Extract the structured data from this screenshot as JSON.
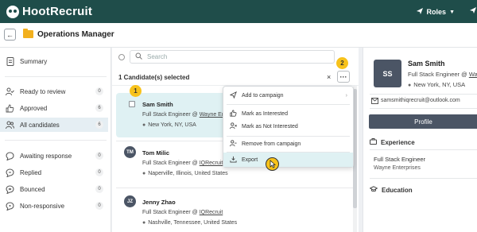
{
  "topbar": {
    "logo_text": "HootRecruit",
    "roles_label": "Roles",
    "colors": {
      "topbar_bg": "#1f4d4a",
      "accent": "#f7c21b"
    }
  },
  "header": {
    "back_icon": "arrow-left-icon",
    "title": "Operations Manager"
  },
  "sidebar": {
    "summary": "Summary",
    "items": [
      {
        "label": "Ready to review",
        "count": "0",
        "icon": "person-check-icon"
      },
      {
        "label": "Approved",
        "count": "6",
        "icon": "thumbs-up-icon"
      },
      {
        "label": "All candidates",
        "count": "6",
        "icon": "people-icon",
        "active": true
      },
      {
        "label": "Awaiting response",
        "count": "0",
        "icon": "chat-icon"
      },
      {
        "label": "Replied",
        "count": "0",
        "icon": "reply-icon"
      },
      {
        "label": "Bounced",
        "count": "0",
        "icon": "bounce-icon"
      },
      {
        "label": "Non-responsive",
        "count": "0",
        "icon": "no-response-icon"
      }
    ]
  },
  "center": {
    "search_placeholder": "Search",
    "selected_text": "1 Candidate(s) selected",
    "close_symbol": "×",
    "more_symbol": "···",
    "step_badges": [
      "1",
      "2"
    ],
    "candidates": [
      {
        "initials": "",
        "name": "Sam Smith",
        "role_prefix": "Full Stack Engineer @ ",
        "company": "Wayne Ent",
        "location": "New York, NY, USA",
        "selected": true
      },
      {
        "initials": "TM",
        "name": "Tom Milic",
        "role_prefix": "Full Stack Engineer @ ",
        "company": "IQRecruit",
        "location": "Naperville, Illinois, United States",
        "selected": false
      },
      {
        "initials": "JZ",
        "name": "Jenny Zhao",
        "role_prefix": "Full Stack Engineer @ ",
        "company": "IQRecruit",
        "location": "Nashville, Tennessee, United States",
        "selected": false
      }
    ]
  },
  "menu": {
    "items": [
      {
        "label": "Add to campaign",
        "icon": "send-icon"
      },
      {
        "label": "Mark as Interested",
        "icon": "thumbs-up-icon"
      },
      {
        "label": "Mark as Not Interested",
        "icon": "person-x-icon"
      },
      {
        "label": "Remove from campaign",
        "icon": "person-remove-icon"
      },
      {
        "label": "Export",
        "icon": "download-icon"
      }
    ]
  },
  "profile": {
    "initials": "SS",
    "name": "Sam Smith",
    "role_prefix": "Full Stack Engineer @ ",
    "company": "Wa",
    "location": "New York, NY, USA",
    "email": "samsmithiqrecruit@outlook.com",
    "profile_button": "Profile",
    "experience_label": "Experience",
    "job_title": "Full Stack Engineer",
    "job_company": "Wayne Enterprises",
    "education_label": "Education"
  }
}
